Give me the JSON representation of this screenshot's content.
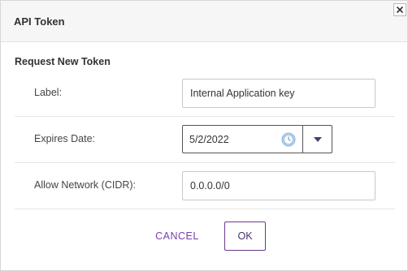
{
  "dialog": {
    "title": "API Token",
    "close_glyph": "✕"
  },
  "form": {
    "section_title": "Request New Token",
    "label": {
      "label": "Label:",
      "value": "Internal Application key"
    },
    "expires": {
      "label": "Expires Date:",
      "value": "5/2/2022",
      "icon": "clock-icon",
      "dropdown_icon": "caret-down-icon"
    },
    "network": {
      "label": "Allow Network (CIDR):",
      "value": "0.0.0.0/0"
    }
  },
  "actions": {
    "cancel_label": "CANCEL",
    "ok_label": "OK"
  },
  "colors": {
    "accent": "#7b3fb0",
    "clock_icon": "#8ab4e0",
    "caret": "#4a3a7a"
  }
}
